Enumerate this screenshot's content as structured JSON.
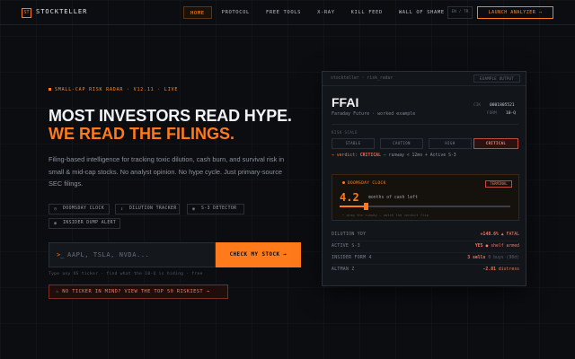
{
  "nav": {
    "logo_mark": "ST",
    "brand": "STOCKTELLER",
    "links": [
      "HOME",
      "PROTOCOL",
      "FREE TOOLS",
      "X-RAY",
      "KILL FEED",
      "WALL OF SHAME"
    ],
    "lang": "EN / TR",
    "launch": "LAUNCH ANALYZER →"
  },
  "hero": {
    "kicker": "SMALL-CAP RISK RADAR · V12.11 · LIVE",
    "title_line1": "MOST INVESTORS READ HYPE.",
    "title_line2": "WE READ THE FILINGS.",
    "description": "Filing-based intelligence for tracking toxic dilution, cash burn, and survival risk in small & mid-cap stocks. No analyst opinion. No hype cycle. Just primary-source SEC filings.",
    "tags": [
      {
        "icon": "clock-icon",
        "glyph": "◷",
        "label": "DOOMSDAY CLOCK"
      },
      {
        "icon": "dilution-icon",
        "glyph": "↕",
        "label": "DILUTION TRACKER"
      },
      {
        "icon": "eye-icon",
        "glyph": "◉",
        "label": "S-3 DETECTOR"
      },
      {
        "icon": "eye-icon",
        "glyph": "◉",
        "label": "INSIDER DUMP ALERT"
      }
    ],
    "search_prompt": ">_",
    "search_placeholder": "AAPL, TSLA, NVDA...",
    "check_button": "CHECK MY STOCK →",
    "helper": "Type any US ticker · find what the 10-Q is hiding · free",
    "riskiest_button": "⚠ NO TICKER IN MIND? VIEW THE TOP 50 RISKIEST →"
  },
  "card": {
    "path": "stockteller · risk_radar",
    "example_badge": "EXAMPLE OUTPUT",
    "ticker": "FFAI",
    "company": "Faraday Future · worked example",
    "cik_label": "CIK",
    "cik_value": "0001805521",
    "form_label": "FORM",
    "form_value": "10-Q",
    "risk_scale_label": "RISK SCALE",
    "scale": [
      "STABLE",
      "CAUTION",
      "HIGH",
      "CRITICAL"
    ],
    "scale_active": "CRITICAL",
    "verdict_prefix": "→ verdict:",
    "verdict_value": "CRITICAL",
    "verdict_suffix": "— runway < 12mo + Active S-3",
    "doomsday": {
      "title": "DOOMSDAY CLOCK",
      "badge": "TERMINAL",
      "value": "4.2",
      "unit": "months of cash left",
      "fill_fraction": 0.15,
      "hint": "← drag the runway — watch the verdict flip"
    },
    "metrics": [
      {
        "label": "DILUTION YOY",
        "value": "+148.6%",
        "note": "▲ FATAL"
      },
      {
        "label": "ACTIVE S-3",
        "value": "YES",
        "note": "● shelf armed"
      },
      {
        "label": "INSIDER FORM 4",
        "value": "3 sells",
        "note": "0 buys (90d)"
      },
      {
        "label": "ALTMAN Z",
        "value": "-2.81",
        "note": "distress"
      }
    ]
  },
  "colors": {
    "accent": "#ff7a1a",
    "critical": "#f06a56",
    "background": "#0b0d11"
  }
}
